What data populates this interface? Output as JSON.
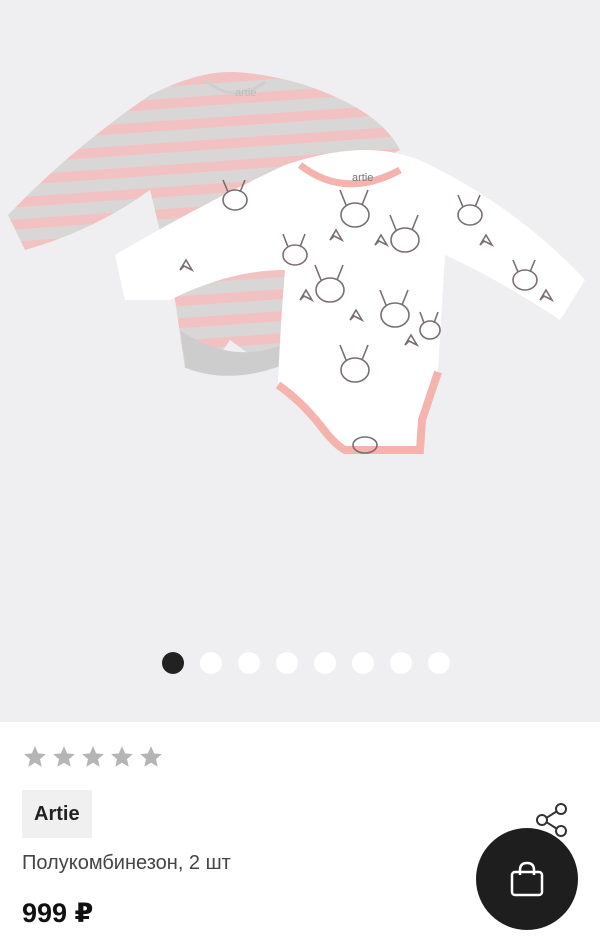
{
  "gallery": {
    "image_alt": "Полукомбинезон, 2 шт",
    "slides_count": 8,
    "active_slide": 1,
    "print_text": "artie"
  },
  "rating": {
    "stars_total": 5,
    "stars_filled": 0,
    "star_color": "#b5b5b5"
  },
  "product": {
    "brand": "Artie",
    "name": "Полукомбинезон, 2 шт",
    "price": "999 ₽"
  },
  "icons": {
    "share": "share-icon",
    "cart": "shopping-bag-icon"
  },
  "colors": {
    "cart_button": "#1e1e1e",
    "active_dot": "#222222",
    "inactive_dot": "#ffffff",
    "gallery_bg": "#efeff1",
    "brand_chip_bg": "#f0f0f0"
  }
}
